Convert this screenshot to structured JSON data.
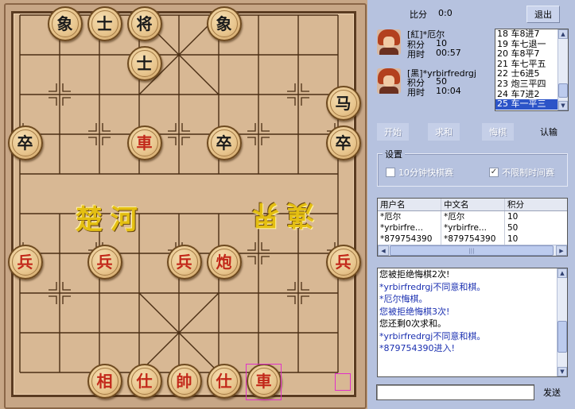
{
  "board": {
    "river_left": "楚河",
    "river_right": "漢界",
    "pieces": [
      {
        "text": "象",
        "side": "black",
        "col": 1,
        "row": 0
      },
      {
        "text": "士",
        "side": "black",
        "col": 2,
        "row": 0
      },
      {
        "text": "将",
        "side": "black",
        "col": 3,
        "row": 0
      },
      {
        "text": "象",
        "side": "black",
        "col": 5,
        "row": 0
      },
      {
        "text": "士",
        "side": "black",
        "col": 3,
        "row": 1
      },
      {
        "text": "马",
        "side": "black",
        "col": 8,
        "row": 2
      },
      {
        "text": "卒",
        "side": "black",
        "col": 0,
        "row": 3
      },
      {
        "text": "車",
        "side": "red",
        "col": 3,
        "row": 3
      },
      {
        "text": "卒",
        "side": "black",
        "col": 5,
        "row": 3
      },
      {
        "text": "卒",
        "side": "black",
        "col": 8,
        "row": 3
      },
      {
        "text": "兵",
        "side": "red",
        "col": 0,
        "row": 6
      },
      {
        "text": "兵",
        "side": "red",
        "col": 2,
        "row": 6
      },
      {
        "text": "兵",
        "side": "red",
        "col": 4,
        "row": 6
      },
      {
        "text": "炮",
        "side": "red",
        "col": 5,
        "row": 6
      },
      {
        "text": "兵",
        "side": "red",
        "col": 8,
        "row": 6
      },
      {
        "text": "相",
        "side": "red",
        "col": 2,
        "row": 9
      },
      {
        "text": "仕",
        "side": "red",
        "col": 3,
        "row": 9
      },
      {
        "text": "帥",
        "side": "red",
        "col": 4,
        "row": 9
      },
      {
        "text": "仕",
        "side": "red",
        "col": 5,
        "row": 9
      },
      {
        "text": "車",
        "side": "red",
        "col": 6,
        "row": 9
      }
    ]
  },
  "score": {
    "label": "比分",
    "value": "0:0"
  },
  "exit_button": "退出",
  "players": [
    {
      "name_line": "[紅]*厄尔",
      "points_label": "积分",
      "points": "10",
      "time_label": "用时",
      "time": "00:57"
    },
    {
      "name_line": "[黑]*yrbirfredrgj",
      "points_label": "积分",
      "points": "50",
      "time_label": "用时",
      "time": "10:04"
    }
  ],
  "moves": [
    "18 车8进7",
    "19 车七退一",
    "20 车8平7",
    "21 车七平五",
    "22 士6进5",
    "23 炮三平四",
    "24 车7进2",
    "25 车一平三"
  ],
  "actions": {
    "start": "开始",
    "draw": "求和",
    "undo": "悔棋",
    "resign": "认输"
  },
  "settings": {
    "title": "设置",
    "fast_game": {
      "label": "10分钟快棋赛",
      "checked": false
    },
    "no_time_limit": {
      "label": "不限制时间赛",
      "checked": true
    }
  },
  "users_table": {
    "headers": [
      "用户名",
      "中文名",
      "积分"
    ],
    "rows": [
      [
        "*厄尔",
        "*厄尔",
        "10"
      ],
      [
        "*yrbirfre...",
        "*yrbirfre...",
        "50"
      ],
      [
        "*879754390",
        "*879754390",
        "10"
      ]
    ]
  },
  "chat": [
    {
      "text": "您被拒绝悔棋2次!",
      "color": "#000000"
    },
    {
      "text": "*yrbirfredrgj不同意和棋。",
      "color": "#1a2fb0"
    },
    {
      "text": "*厄尔悔棋。",
      "color": "#1a2fb0"
    },
    {
      "text": "您被拒绝悔棋3次!",
      "color": "#1a2fb0"
    },
    {
      "text": "您还剩0次求和。",
      "color": "#000000"
    },
    {
      "text": "*yrbirfredrgj不同意和棋。",
      "color": "#1a2fb0"
    },
    {
      "text": "*879754390进入!",
      "color": "#1a2fb0"
    }
  ],
  "send_button": "发送",
  "chat_input_value": ""
}
